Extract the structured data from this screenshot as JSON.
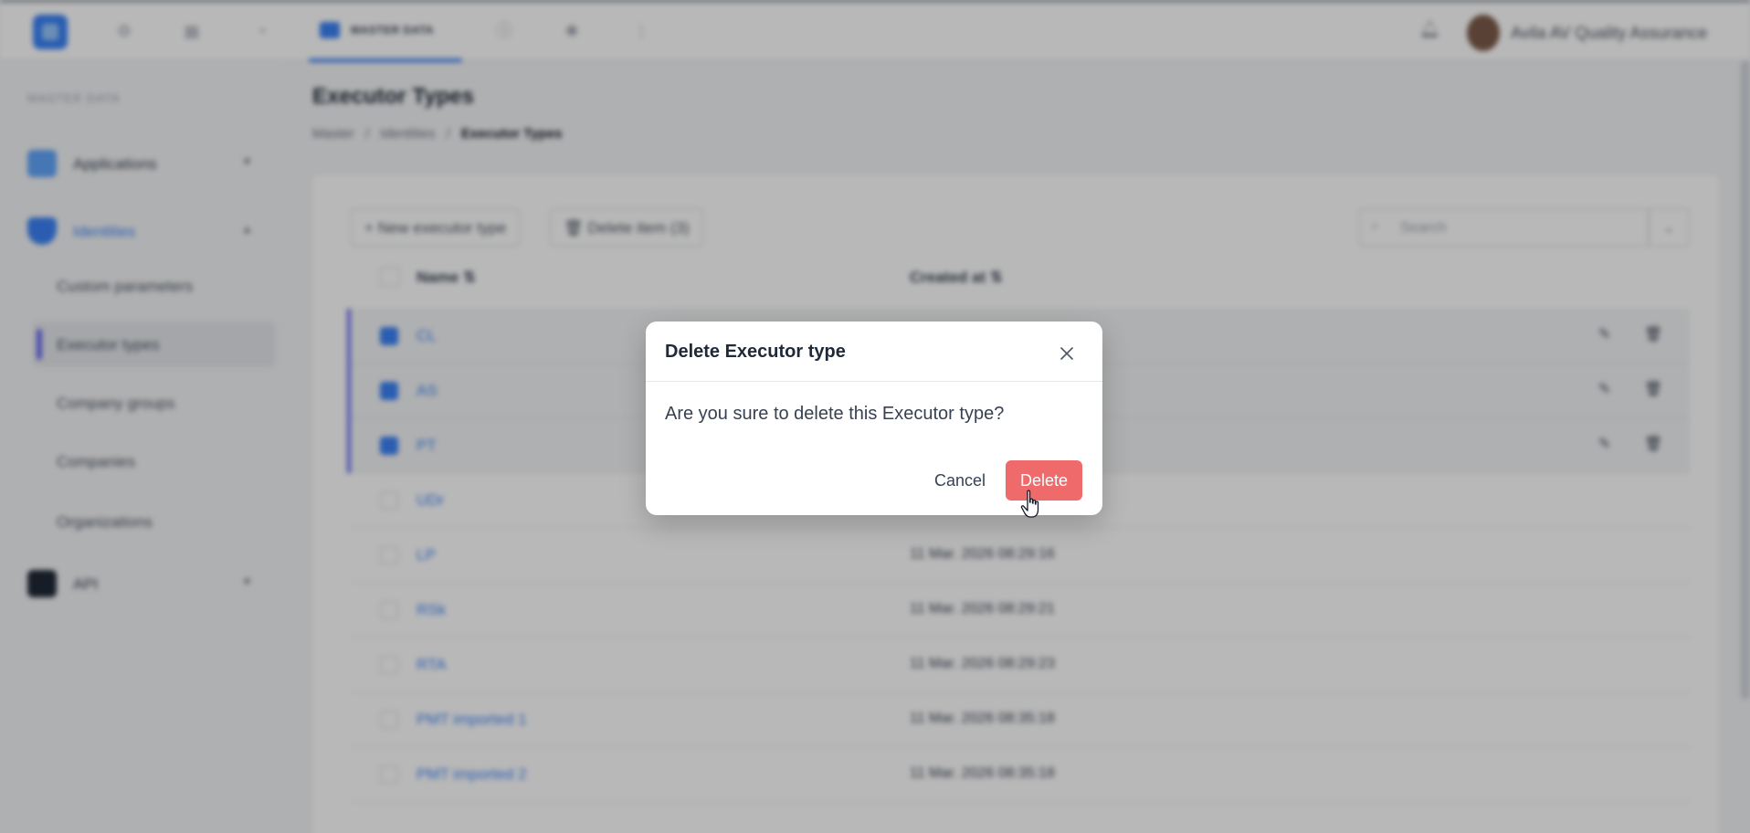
{
  "topbar": {
    "active_tab_label": "MASTER DATA",
    "user_name": "Avila AV Quality Assurance"
  },
  "sidebar": {
    "section_title": "MASTER DATA",
    "groups": [
      {
        "label": "Applications"
      },
      {
        "label": "Identities"
      },
      {
        "label": "API"
      }
    ],
    "items": [
      {
        "label": "Custom parameters"
      },
      {
        "label": "Executor types"
      },
      {
        "label": "Company groups"
      },
      {
        "label": "Companies"
      },
      {
        "label": "Organizations"
      }
    ]
  },
  "main": {
    "title": "Executor Types",
    "breadcrumb": {
      "part1": "Master",
      "part2": "Identities",
      "current": "Executor Types",
      "sep": "/"
    },
    "new_button": "+ New executor type",
    "delete_items_button": "Delete item (3)",
    "search_placeholder": "Search",
    "columns": {
      "name": "Name",
      "created_at": "Created at"
    },
    "rows": [
      {
        "name": "CL",
        "date": "",
        "selected": true
      },
      {
        "name": "AS",
        "date": "",
        "selected": true
      },
      {
        "name": "PT",
        "date": "",
        "selected": true
      },
      {
        "name": "UDr",
        "date": "",
        "selected": false
      },
      {
        "name": "LP",
        "date": "11 Mar. 2026 08:29:16",
        "selected": false
      },
      {
        "name": "RSk",
        "date": "11 Mar. 2026 08:29:21",
        "selected": false
      },
      {
        "name": "RTA",
        "date": "11 Mar. 2026 08:29:23",
        "selected": false
      },
      {
        "name": "PMT imported 1",
        "date": "11 Mar. 2026 08:35:18",
        "selected": false
      },
      {
        "name": "PMT imported 2",
        "date": "11 Mar. 2026 08:35:18",
        "selected": false
      }
    ]
  },
  "modal": {
    "title": "Delete Executor type",
    "message": "Are you sure to delete this Executor type?",
    "cancel_label": "Cancel",
    "delete_label": "Delete"
  },
  "colors": {
    "accent": "#3b82f6",
    "danger": "#ef6b6b",
    "selection_bar": "#6366f1"
  }
}
